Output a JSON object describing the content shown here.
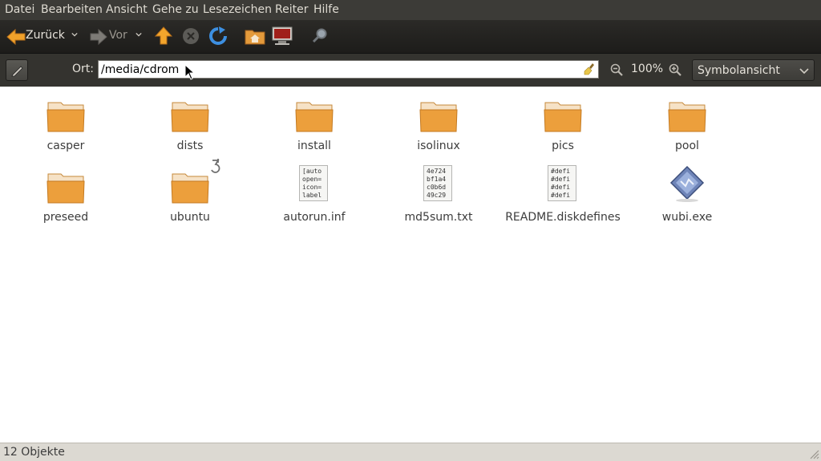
{
  "menubar": {
    "items": [
      "Datei",
      "Bearbeiten",
      "Ansicht",
      "Gehe zu",
      "Lesezeichen",
      "Reiter",
      "Hilfe"
    ]
  },
  "toolbar": {
    "back_label": "Zurück",
    "forward_label": "Vor"
  },
  "location": {
    "label": "Ort:",
    "path": "/media/cdrom",
    "zoom_level": "100%",
    "view_mode": "Symbolansicht"
  },
  "files": [
    {
      "name": "casper",
      "kind": "folder"
    },
    {
      "name": "dists",
      "kind": "folder"
    },
    {
      "name": "install",
      "kind": "folder"
    },
    {
      "name": "isolinux",
      "kind": "folder"
    },
    {
      "name": "pics",
      "kind": "folder"
    },
    {
      "name": "pool",
      "kind": "folder"
    },
    {
      "name": "preseed",
      "kind": "folder"
    },
    {
      "name": "ubuntu",
      "kind": "folder-link"
    },
    {
      "name": "autorun.inf",
      "kind": "text",
      "preview": [
        "[auto",
        "open=",
        "icon=",
        "label"
      ]
    },
    {
      "name": "md5sum.txt",
      "kind": "text",
      "preview": [
        "4e724",
        "bf1a4",
        "c0b6d",
        "49c29"
      ]
    },
    {
      "name": "README.diskdefines",
      "kind": "text",
      "preview": [
        "#defi",
        "#defi",
        "#defi",
        "#defi"
      ]
    },
    {
      "name": "wubi.exe",
      "kind": "executable"
    }
  ],
  "status": {
    "text": "12 Objekte"
  },
  "colors": {
    "menubar_bg": "#3c3b37",
    "toolbar_bg": "#2b2a27",
    "folder_orange": "#e99b3a",
    "statusbar_bg": "#dcd9d2"
  }
}
